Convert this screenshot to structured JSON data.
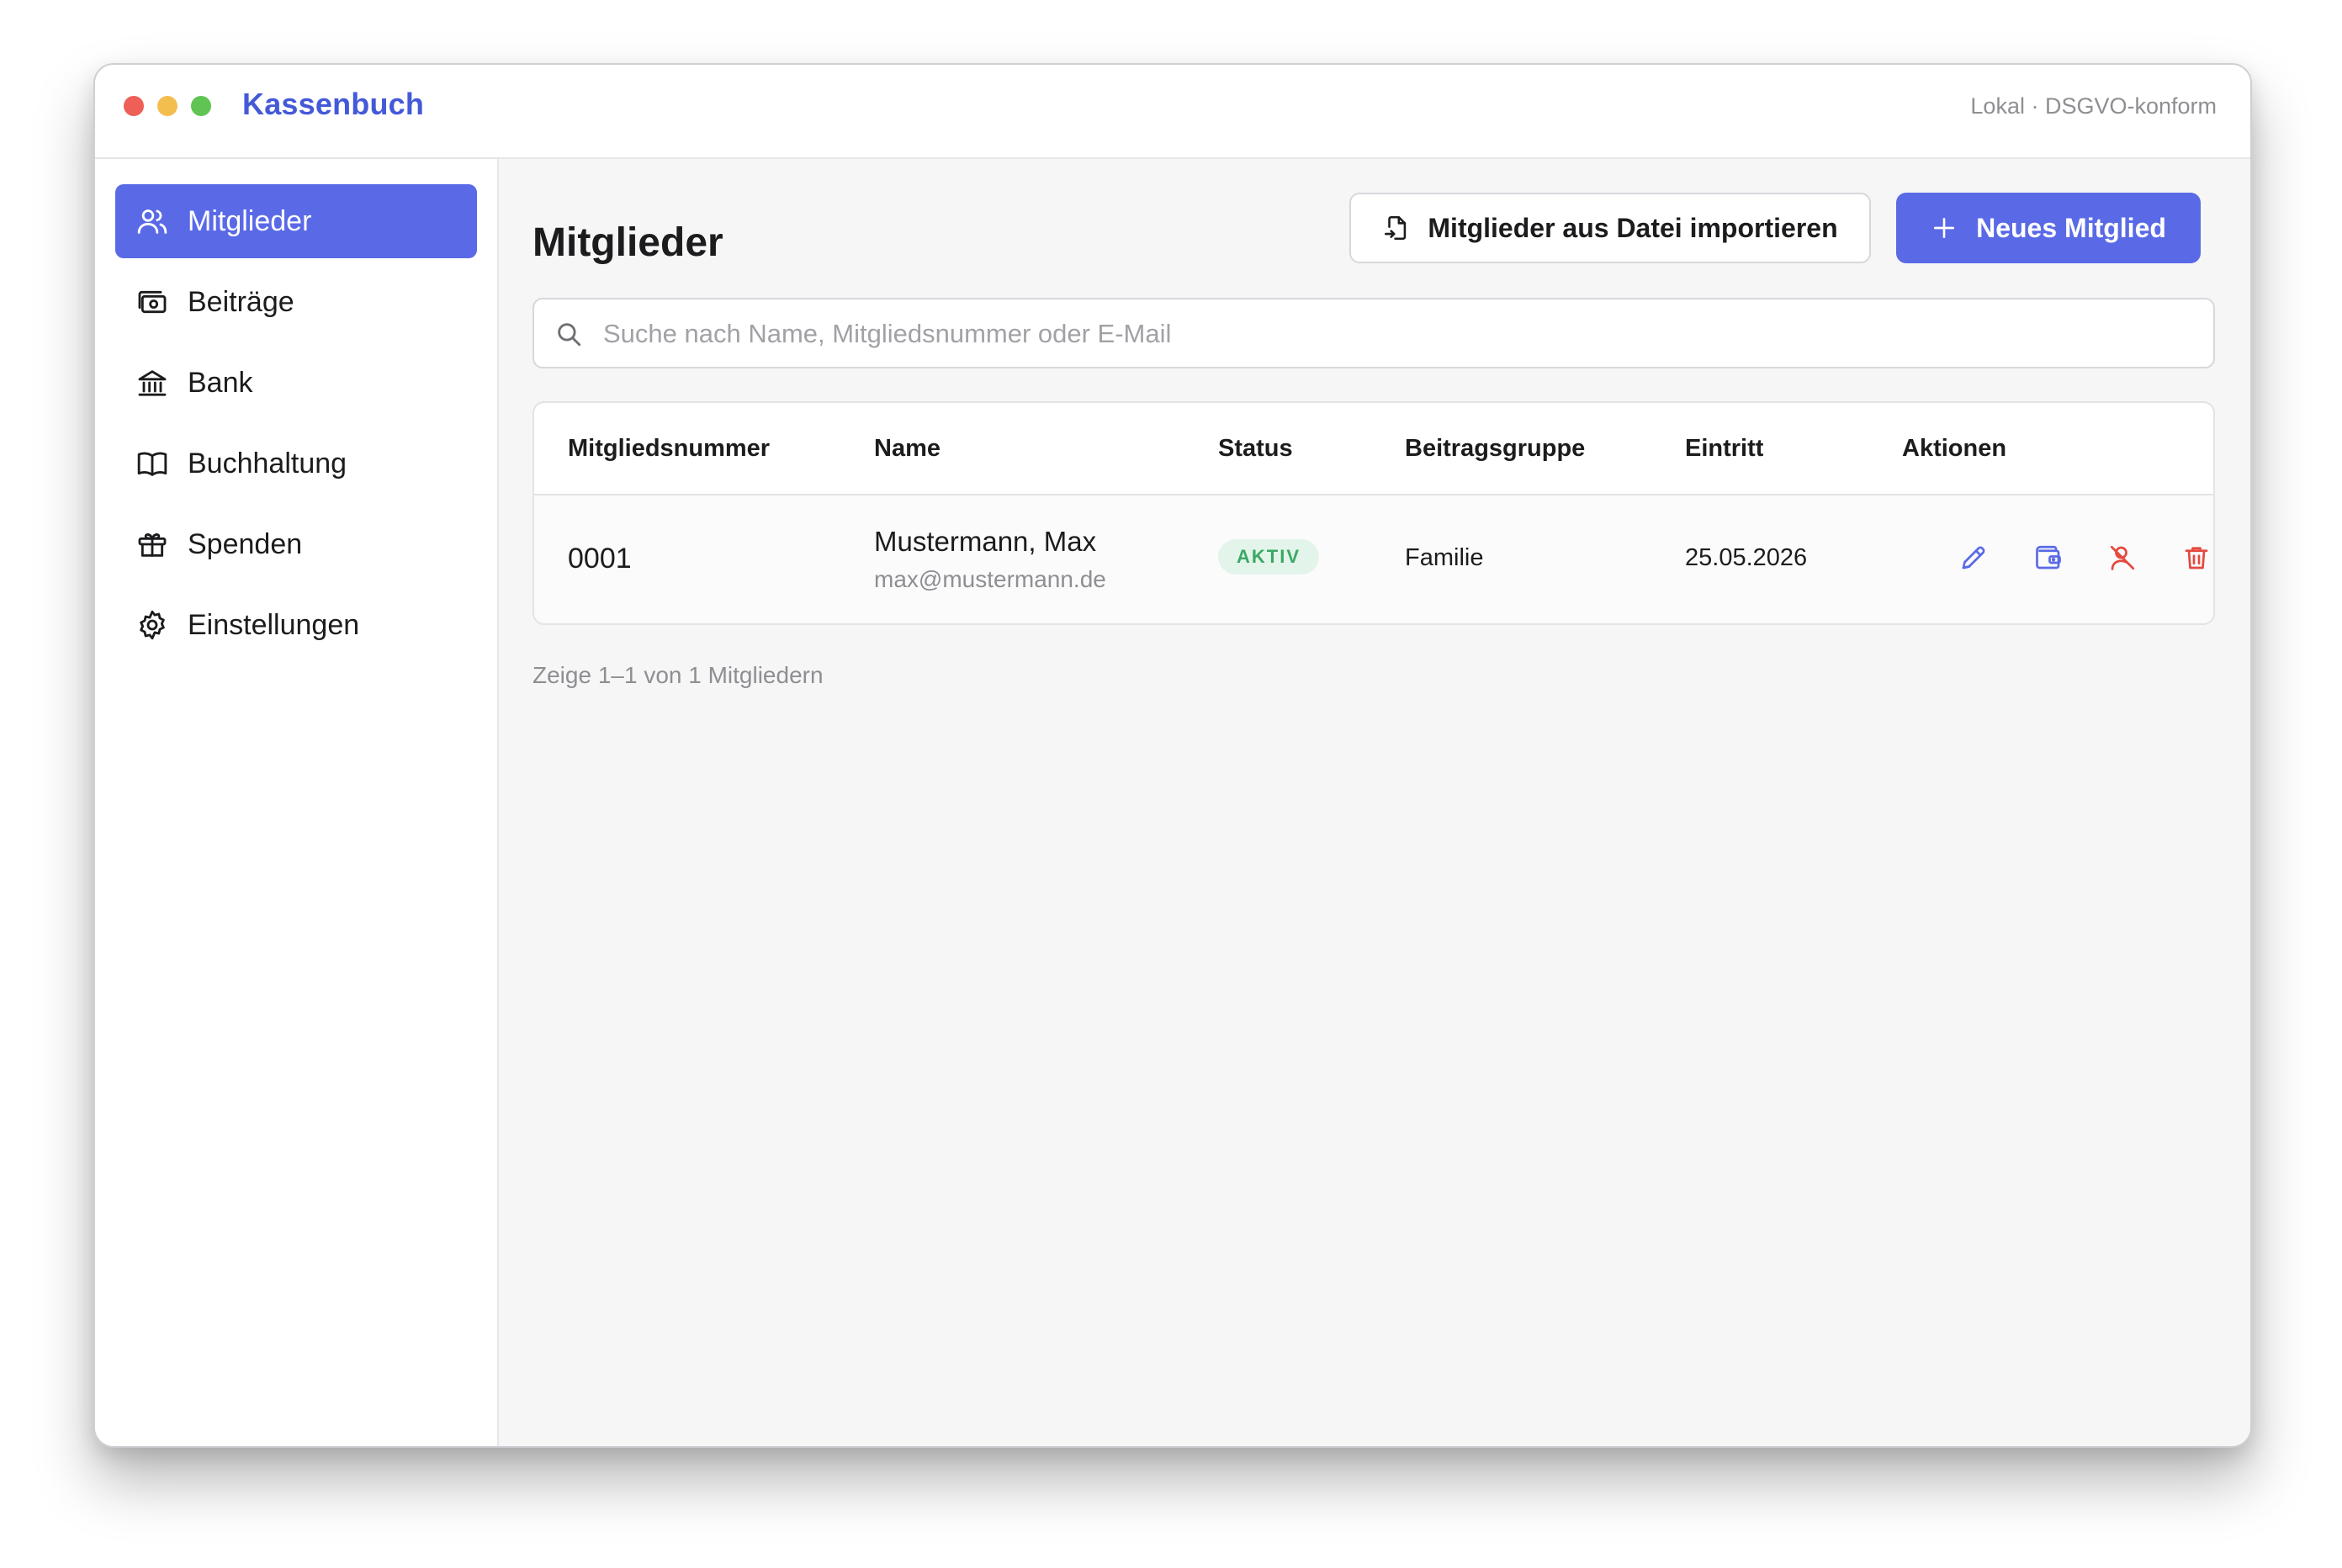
{
  "app": {
    "title": "Kassenbuch",
    "badge": "Lokal · DSGVO-konform"
  },
  "colors": {
    "accent": "#5a6ae6",
    "app_title": "#4459d8",
    "danger": "#e5483d",
    "success": "#3aa864",
    "traffic_red": "#ee5f57",
    "traffic_yellow": "#f4be4f",
    "traffic_green": "#5fc453"
  },
  "sidebar": {
    "items": [
      {
        "label": "Mitglieder",
        "icon": "users-icon",
        "active": true
      },
      {
        "label": "Beiträge",
        "icon": "cash-icon",
        "active": false
      },
      {
        "label": "Bank",
        "icon": "bank-icon",
        "active": false
      },
      {
        "label": "Buchhaltung",
        "icon": "book-icon",
        "active": false
      },
      {
        "label": "Spenden",
        "icon": "gift-icon",
        "active": false
      },
      {
        "label": "Einstellungen",
        "icon": "gear-icon",
        "active": false
      }
    ]
  },
  "main": {
    "title": "Mitglieder",
    "import_button": "Mitglieder aus Datei importieren",
    "new_button": "Neues Mitglied",
    "search": {
      "placeholder": "Suche nach Name, Mitgliedsnummer oder E-Mail",
      "value": ""
    },
    "table": {
      "columns": [
        "Mitgliedsnummer",
        "Name",
        "Status",
        "Beitragsgruppe",
        "Eintritt",
        "Aktionen"
      ],
      "rows": [
        {
          "nr": "0001",
          "name": "Mustermann, Max",
          "email": "max@mustermann.de",
          "status": "AKTIV",
          "group": "Familie",
          "date": "25.05.2026",
          "actions": [
            "edit-icon",
            "wallet-icon",
            "deactivate-user-icon",
            "trash-icon"
          ]
        }
      ]
    },
    "count_text": "Zeige 1–1 von 1 Mitgliedern"
  }
}
